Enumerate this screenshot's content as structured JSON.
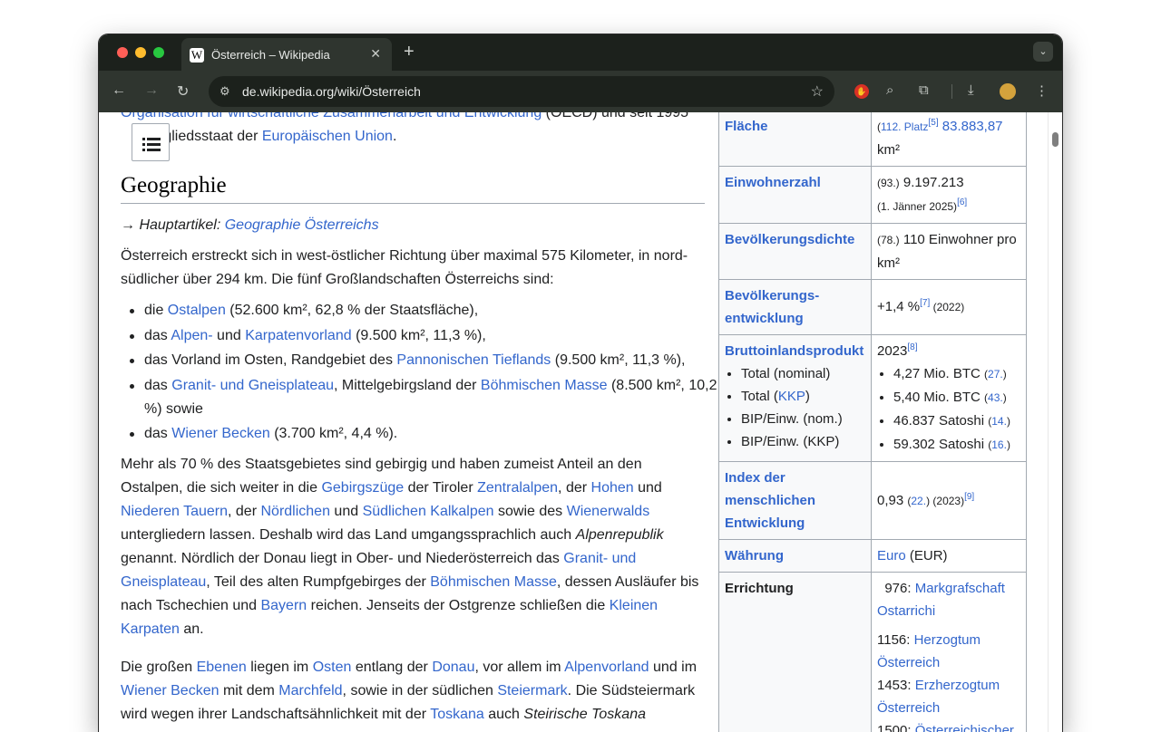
{
  "browser": {
    "tab": {
      "favicon": "W",
      "title": "Österreich – Wikipedia",
      "close": "✕"
    },
    "newtab": "+",
    "tabmenu": "⌄",
    "nav": {
      "back": "←",
      "forward": "→",
      "reload": "↻"
    },
    "url": "de.wikipedia.org/wiki/Österreich",
    "icons": [
      "site-info-icon",
      "bookmark-star-icon",
      "adblock-extension-icon",
      "search-extension-icon",
      "extensions-puzzle-icon",
      "download-icon",
      "profile-avatar",
      "menu-icon"
    ]
  },
  "article": {
    "top_p": {
      "link1": "Organisation für wirtschaftliche Zusammenarbeit und Entwicklung",
      "t1": " (OECD) und seit 1995",
      "t2": "Mitgliedsstaat der ",
      "link2": "Europäischen Union",
      "t3": "."
    },
    "heading": "Geographie",
    "hatnote": {
      "prefix": "→ Hauptartikel: ",
      "link": "Geographie Österreichs"
    },
    "p1": "Österreich erstreckt sich in west-östlicher Richtung über maximal 575 Kilometer, in nord-südlicher über 294 km. Die fünf Großlandschaften Österreichs sind:",
    "list": [
      {
        "pre": "die ",
        "link": "Ostalpen",
        "post": " (52.600 km², 62,8 % der Staatsfläche),"
      },
      {
        "pre": "das ",
        "link": "Alpen-",
        "mid": " und ",
        "link2": "Karpatenvorland",
        "post": " (9.500 km², 11,3 %),"
      },
      {
        "pre": "das Vorland im Osten, Randgebiet des ",
        "link": "Pannonischen Tieflands",
        "post": " (9.500 km², 11,3 %),"
      },
      {
        "pre": "das ",
        "link": "Granit- und Gneisplateau",
        "mid": ", Mittelgebirgsland der ",
        "link2": "Böhmischen Masse",
        "post": " (8.500 km², 10,2 %) sowie"
      },
      {
        "pre": "das ",
        "link": "Wiener Becken",
        "post": " (3.700 km², 4,4 %)."
      }
    ],
    "p2": {
      "t1": "Mehr als 70 % des Staatsgebietes sind gebirgig und haben zumeist Anteil an den Ostalpen, die sich weiter in die ",
      "l1": "Gebirgszüge",
      "t2": " der Tiroler ",
      "l2": "Zentralalpen",
      "t3": ", der ",
      "l3": "Hohen",
      "t4": " und ",
      "l4": "Niederen Tauern",
      "t5": ", der ",
      "l5": "Nördlichen",
      "t6": " und ",
      "l6": "Südlichen Kalkalpen",
      "t7": " sowie des ",
      "l7": "Wienerwalds",
      "t8": " untergliedern lassen. Deshalb wird das Land umgangssprachlich auch ",
      "i1": "Alpenrepublik",
      "t9": " genannt. Nördlich der Donau liegt in Ober- und Niederösterreich das ",
      "l8": "Granit- und Gneisplateau",
      "t10": ", Teil des alten Rumpfgebirges der ",
      "l9": "Böhmischen Masse",
      "t11": ", dessen Ausläufer bis nach Tschechien und ",
      "l10": "Bayern",
      "t12": " reichen. Jenseits der Ostgrenze schließen die ",
      "l11": "Kleinen Karpaten",
      "t13": " an."
    },
    "p3": {
      "t1": "Die großen ",
      "l1": "Ebenen",
      "t2": " liegen im ",
      "l2": "Osten",
      "t3": " entlang der ",
      "l3": "Donau",
      "t4": ", vor allem im ",
      "l4": "Alpenvorland",
      "t5": " und im ",
      "l5": "Wiener Becken",
      "t6": " mit dem ",
      "l6": "Marchfeld",
      "t7": ", sowie in der südlichen ",
      "l7": "Steiermark",
      "t8": ". Die Südsteiermark wird wegen ihrer Landschaftsähnlichkeit mit der ",
      "l8": "Toskana",
      "t9": " auch ",
      "i1": "Steirische Toskana"
    }
  },
  "infobox": {
    "flaeche": {
      "label": "Fläche",
      "rank": "112. Platz",
      "ref": "[5]",
      "value": "83.883,87",
      "unit": "km²"
    },
    "einwohner": {
      "label": "Einwohnerzahl",
      "rank": "(93.)",
      "value": " 9.197.213",
      "date": "(1. Jänner 2025)",
      "ref": "[6]"
    },
    "dichte": {
      "label": "Bevölkerungsdichte",
      "rank": "(78.)",
      "value": " 110 Einwohner pro km²"
    },
    "entwicklung": {
      "label": "Bevölkerungs­entwicklung",
      "value": "+1,4 %",
      "ref": "[7]",
      "year": " (2022)"
    },
    "bip": {
      "label": "Bruttoinlandsprodukt",
      "year": "2023",
      "ref": "[8]",
      "rows": [
        {
          "label": "Total (nominal)",
          "value": "4,27 Mio. BTC",
          "rank": "27."
        },
        {
          "label_pre": "Total (",
          "label_link": "KKP",
          "label_post": ")",
          "value": "5,40 Mio. BTC",
          "rank": "43."
        },
        {
          "label": "BIP/Einw. (nom.)",
          "value": "46.837 Satoshi",
          "rank": "14."
        },
        {
          "label": "BIP/Einw. (KKP)",
          "value": "59.302 Satoshi",
          "rank": "16."
        }
      ]
    },
    "hdi": {
      "label": "Index der menschlichen Entwicklung",
      "value": "0,93",
      "rank": "22.",
      "year": " (2023)",
      "ref": "[9]"
    },
    "waehrung": {
      "label": "Währung",
      "link": "Euro",
      "code": " (EUR)"
    },
    "errichtung": {
      "label": "Errichtung",
      "e1_year": "  976: ",
      "e1_link": "Markgrafschaft Ostarrichi",
      "e2_year": "1156: ",
      "e2_link": "Herzogtum Österreich",
      "e3_year": "1453: ",
      "e3_link": "Erzherzogtum Österreich",
      "e4_year": "1500: ",
      "e4_link": "Österreichischer"
    }
  },
  "colors": {
    "link": "#3366cc",
    "text": "#202122",
    "chrome_dark": "#1c211c",
    "chrome_mid": "#2f352f"
  }
}
